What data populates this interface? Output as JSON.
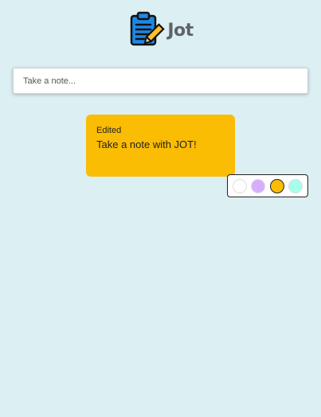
{
  "app": {
    "name": "Jot",
    "logo_icon": "clipboard-pencil-icon"
  },
  "search": {
    "placeholder": "Take a note...",
    "value": ""
  },
  "note": {
    "status": "Edited",
    "text": "Take a note with JOT!",
    "color": "#fbbc04"
  },
  "palette": {
    "swatches": [
      {
        "name": "white",
        "color": "#ffffff",
        "selected": false
      },
      {
        "name": "purple",
        "color": "#d7aefb",
        "selected": false
      },
      {
        "name": "yellow",
        "color": "#fbbc04",
        "selected": true
      },
      {
        "name": "teal",
        "color": "#a7ffeb",
        "selected": false
      }
    ]
  },
  "theme": {
    "background": "#dcf0f3",
    "logo_blue": "#1e88e5",
    "pencil_yellow": "#fbc02d"
  }
}
